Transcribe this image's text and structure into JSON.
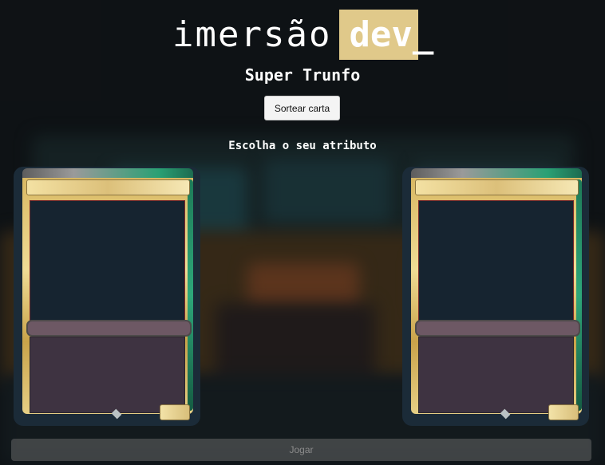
{
  "logo": {
    "word": "imersão",
    "highlight": "dev_",
    "highlight_color": "#e0c98a"
  },
  "title": "Super Trunfo",
  "draw_button": "Sortear carta",
  "choose_attribute": "Escolha o seu atributo",
  "play_button": "Jogar",
  "cards": [
    {
      "id": "player-card"
    },
    {
      "id": "machine-card"
    }
  ]
}
